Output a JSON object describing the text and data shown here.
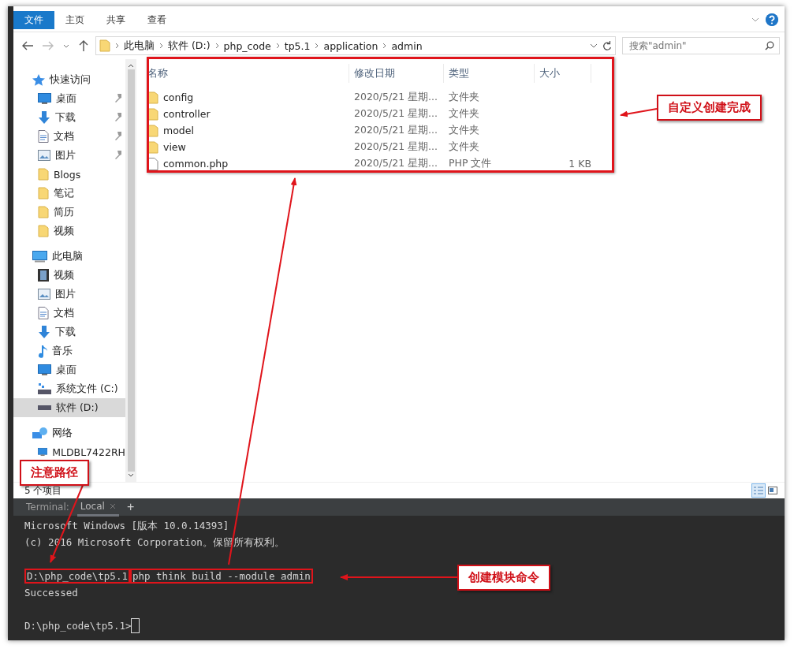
{
  "ribbon": {
    "tabs": [
      {
        "label": "文件",
        "selected": true
      },
      {
        "label": "主页",
        "selected": false
      },
      {
        "label": "共享",
        "selected": false
      },
      {
        "label": "查看",
        "selected": false
      }
    ]
  },
  "address_bar": {
    "crumbs": [
      "此电脑",
      "软件 (D:)",
      "php_code",
      "tp5.1",
      "application",
      "admin"
    ]
  },
  "search": {
    "placeholder": "搜索\"admin\""
  },
  "sidebar": {
    "items": [
      {
        "label": "快速访问",
        "kind": "star",
        "selected": false,
        "children": [
          {
            "label": "桌面",
            "kind": "desktop",
            "pinned": true,
            "selected": false
          },
          {
            "label": "下载",
            "kind": "download",
            "pinned": true,
            "selected": false
          },
          {
            "label": "文档",
            "kind": "document",
            "pinned": true,
            "selected": false
          },
          {
            "label": "图片",
            "kind": "picture",
            "pinned": true,
            "selected": false
          },
          {
            "label": "Blogs",
            "kind": "folder",
            "pinned": false,
            "selected": false
          },
          {
            "label": "笔记",
            "kind": "folder",
            "pinned": false,
            "selected": false
          },
          {
            "label": "简历",
            "kind": "folder",
            "pinned": false,
            "selected": false
          },
          {
            "label": "视频",
            "kind": "folder",
            "pinned": false,
            "selected": false
          }
        ]
      },
      {
        "label": "此电脑",
        "kind": "pc",
        "selected": false,
        "children": [
          {
            "label": "视频",
            "kind": "video",
            "pinned": false,
            "selected": false
          },
          {
            "label": "图片",
            "kind": "picture",
            "pinned": false,
            "selected": false
          },
          {
            "label": "文档",
            "kind": "document",
            "pinned": false,
            "selected": false
          },
          {
            "label": "下载",
            "kind": "download",
            "pinned": false,
            "selected": false
          },
          {
            "label": "音乐",
            "kind": "music",
            "pinned": false,
            "selected": false
          },
          {
            "label": "桌面",
            "kind": "desktop",
            "pinned": false,
            "selected": false
          },
          {
            "label": "系统文件 (C:)",
            "kind": "system-drive",
            "pinned": false,
            "selected": false
          },
          {
            "label": "软件 (D:)",
            "kind": "drive",
            "pinned": false,
            "selected": true
          }
        ]
      },
      {
        "label": "网络",
        "kind": "network",
        "selected": false,
        "children": [
          {
            "label": "MLDBL7422RH",
            "kind": "desktop",
            "pinned": false,
            "selected": false
          }
        ]
      }
    ]
  },
  "file_list": {
    "columns": [
      "名称",
      "修改日期",
      "类型",
      "大小"
    ],
    "rows": [
      {
        "name": "config",
        "modified": "2020/5/21 星期...",
        "type": "文件夹",
        "kind": "folder"
      },
      {
        "name": "controller",
        "modified": "2020/5/21 星期...",
        "type": "文件夹",
        "kind": "folder"
      },
      {
        "name": "model",
        "modified": "2020/5/21 星期...",
        "type": "文件夹",
        "kind": "folder"
      },
      {
        "name": "view",
        "modified": "2020/5/21 星期...",
        "type": "文件夹",
        "kind": "folder"
      },
      {
        "name": "common.php",
        "modified": "2020/5/21 星期...",
        "type": "PHP 文件",
        "size": "1 KB",
        "kind": "file"
      }
    ]
  },
  "status_bar": {
    "text": "5 个项目",
    "views": [
      {
        "kind": "details",
        "selected": true
      },
      {
        "kind": "tiles",
        "selected": false
      }
    ]
  },
  "terminal": {
    "label": "Terminal:",
    "tabs": [
      {
        "label": "Local",
        "selected": true
      }
    ],
    "add": "+",
    "lines": [
      {
        "kind": "output",
        "text": "Microsoft Windows [版本 10.0.14393]"
      },
      {
        "kind": "output",
        "text": "(c) 2016 Microsoft Corporation。保留所有权利。"
      },
      {
        "kind": "command",
        "prompt": "D:\\php_code\\tp5.1",
        "command": "php think build --module admin"
      },
      {
        "kind": "output",
        "text": "Successed"
      },
      {
        "kind": "prompt",
        "prompt": "D:\\php_code\\tp5.1>"
      }
    ]
  },
  "annotations": [
    {
      "kind": "list",
      "text": "自定义创建完成"
    },
    {
      "kind": "path",
      "text": "注意路径"
    },
    {
      "kind": "command",
      "text": "创建模块命令"
    }
  ]
}
